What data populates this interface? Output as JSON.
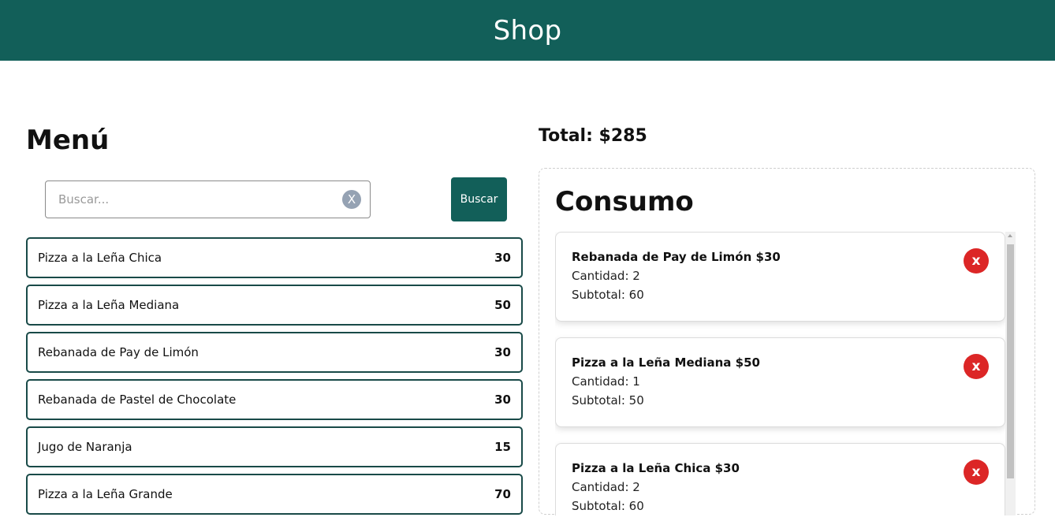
{
  "header": {
    "title": "Shop"
  },
  "menu": {
    "title": "Menú",
    "search": {
      "placeholder": "Buscar...",
      "value": "",
      "clear_label": "X",
      "button_label": "Buscar"
    },
    "items": [
      {
        "name": "Pizza a la Leña Chica",
        "price": "30"
      },
      {
        "name": "Pizza a la Leña Mediana",
        "price": "50"
      },
      {
        "name": "Rebanada de Pay de Limón",
        "price": "30"
      },
      {
        "name": "Rebanada de Pastel de Chocolate",
        "price": "30"
      },
      {
        "name": "Jugo de Naranja",
        "price": "15"
      },
      {
        "name": "Pizza a la Leña Grande",
        "price": "70"
      }
    ]
  },
  "order": {
    "total": "Total: $285",
    "title": "Consumo",
    "items": [
      {
        "title": "Rebanada de Pay de Limón $30",
        "quantity": "Cantidad: 2",
        "subtotal": "Subtotal: 60",
        "remove_label": "x"
      },
      {
        "title": "Pizza a la Leña Mediana $50",
        "quantity": "Cantidad: 1",
        "subtotal": "Subtotal: 50",
        "remove_label": "x"
      },
      {
        "title": "Pizza a la Leña Chica $30",
        "quantity": "Cantidad: 2",
        "subtotal": "Subtotal: 60",
        "remove_label": "x"
      }
    ]
  },
  "colors": {
    "brand": "#125f59",
    "border": "#194a48",
    "remove": "#dc2626",
    "clear": "#95a2b3"
  }
}
